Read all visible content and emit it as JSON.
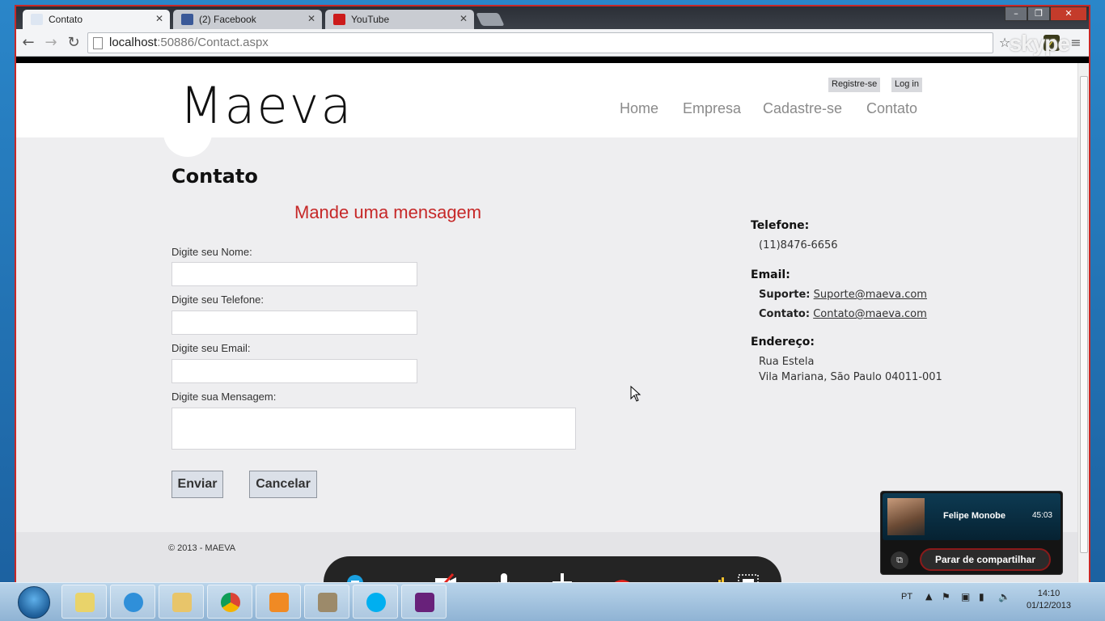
{
  "browser": {
    "tabs": [
      {
        "label": "Contato",
        "fav_color": "#dde6f2"
      },
      {
        "label": "(2) Facebook",
        "fav_color": "#3b5998"
      },
      {
        "label": "YouTube",
        "fav_color": "#cc1b1b"
      }
    ],
    "url_host": "localhost",
    "url_rest": ":50886/Contact.aspx",
    "skype_watermark": "skype"
  },
  "header": {
    "logo": "Maeva",
    "register": "Registre-se",
    "login": "Log in",
    "nav": [
      "Home",
      "Empresa",
      "Cadastre-se",
      "Contato"
    ]
  },
  "main": {
    "title": "Contato",
    "subtitle": "Mande uma mensagem",
    "labels": {
      "nome": "Digite seu Nome:",
      "telefone": "Digite seu Telefone:",
      "email": "Digite seu Email:",
      "mensagem": "Digite sua Mensagem:"
    },
    "send": "Enviar",
    "cancel": "Cancelar"
  },
  "sidebar": {
    "phone_heading": "Telefone:",
    "phone": "(11)8476-6656",
    "email_heading": "Email:",
    "support_label": "Suporte:",
    "support_email": "Suporte@maeva.com",
    "contact_label": "Contato:",
    "contact_email": "Contato@maeva.com",
    "address_heading": "Endereço:",
    "address_line1": "Rua Estela",
    "address_line2": "Vila Mariana, São Paulo 04011-001"
  },
  "footer": {
    "copyright": "© 2013 - MAEVA"
  },
  "skype_call": {
    "contact_name": "Felipe Monobe",
    "duration": "45:03",
    "stop_sharing": "Parar de compartilhar"
  },
  "taskbar": {
    "language": "PT",
    "time": "14:10",
    "date": "01/12/2013"
  },
  "colors": {
    "accent_red": "#c62828",
    "nav_gray": "#8a8a8a"
  }
}
